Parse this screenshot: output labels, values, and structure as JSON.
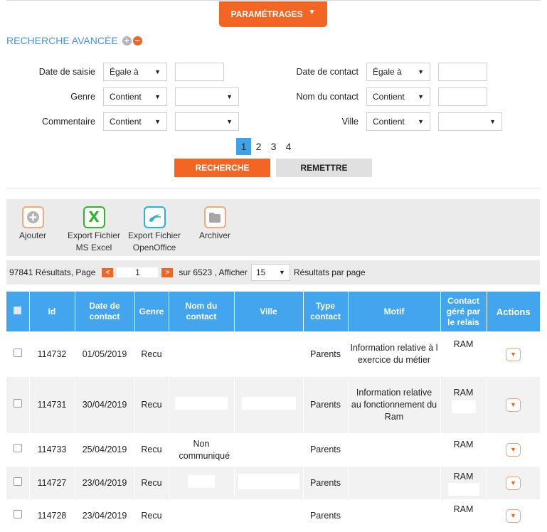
{
  "header": {
    "parametrages_label": "PARAMÉTRAGES"
  },
  "search": {
    "title": "RECHERCHE AVANCÉE",
    "fields": {
      "date_saisie": {
        "label": "Date de saisie",
        "operator": "Égale à",
        "value": ""
      },
      "date_contact": {
        "label": "Date de contact",
        "operator": "Égale à",
        "value": ""
      },
      "genre": {
        "label": "Genre",
        "operator": "Contient",
        "value": ""
      },
      "nom_contact": {
        "label": "Nom du contact",
        "operator": "Contient",
        "value": ""
      },
      "commentaire": {
        "label": "Commentaire",
        "operator": "Contient",
        "value": ""
      },
      "ville": {
        "label": "Ville",
        "operator": "Contient",
        "value": ""
      }
    },
    "pages": [
      "1",
      "2",
      "3",
      "4"
    ],
    "search_button": "RECHERCHE",
    "reset_button": "REMETTRE"
  },
  "toolbar": {
    "add": "Ajouter",
    "excel_1": "Export Fichier",
    "excel_2": "MS Excel",
    "oo_1": "Export Fichier",
    "oo_2": "OpenOffice",
    "archive": "Archiver"
  },
  "results": {
    "count_text": "97841 Résultats, Page",
    "prev": "<",
    "page_value": "1",
    "next": ">",
    "of_text": "sur 6523 , Afficher",
    "per_page": "15",
    "per_page_suffix": "Résultats par page"
  },
  "table": {
    "headers": {
      "id": "Id",
      "date": "Date de contact",
      "genre": "Genre",
      "nom": "Nom du contact",
      "ville": "Ville",
      "type": "Type contact",
      "motif": "Motif",
      "gere": "Contact géré par le relais",
      "actions": "Actions"
    },
    "rows": [
      {
        "id": "114732",
        "date": "01/05/2019",
        "genre": "Recu",
        "nom": "",
        "ville": "",
        "type": "Parents",
        "motif": "Information relative à l exercice du métier",
        "gere": "RAM"
      },
      {
        "id": "114731",
        "date": "30/04/2019",
        "genre": "Recu",
        "nom": "",
        "ville": "",
        "type": "Parents",
        "motif": "Information relative au fonctionnement du Ram",
        "gere": "RAM"
      },
      {
        "id": "114733",
        "date": "25/04/2019",
        "genre": "Recu",
        "nom": "Non communiqué",
        "ville": "",
        "type": "Parents",
        "motif": "",
        "gere": "RAM"
      },
      {
        "id": "114727",
        "date": "23/04/2019",
        "genre": "Recu",
        "nom": "",
        "ville": "",
        "type": "Parents",
        "motif": "",
        "gere": "RAM"
      },
      {
        "id": "114728",
        "date": "23/04/2019",
        "genre": "Recu",
        "nom": "",
        "ville": "",
        "type": "Parents",
        "motif": "",
        "gere": "RAM"
      }
    ]
  },
  "colors": {
    "accent": "#f26522",
    "header_blue": "#42a5ee",
    "link_blue": "#4a90d9"
  }
}
